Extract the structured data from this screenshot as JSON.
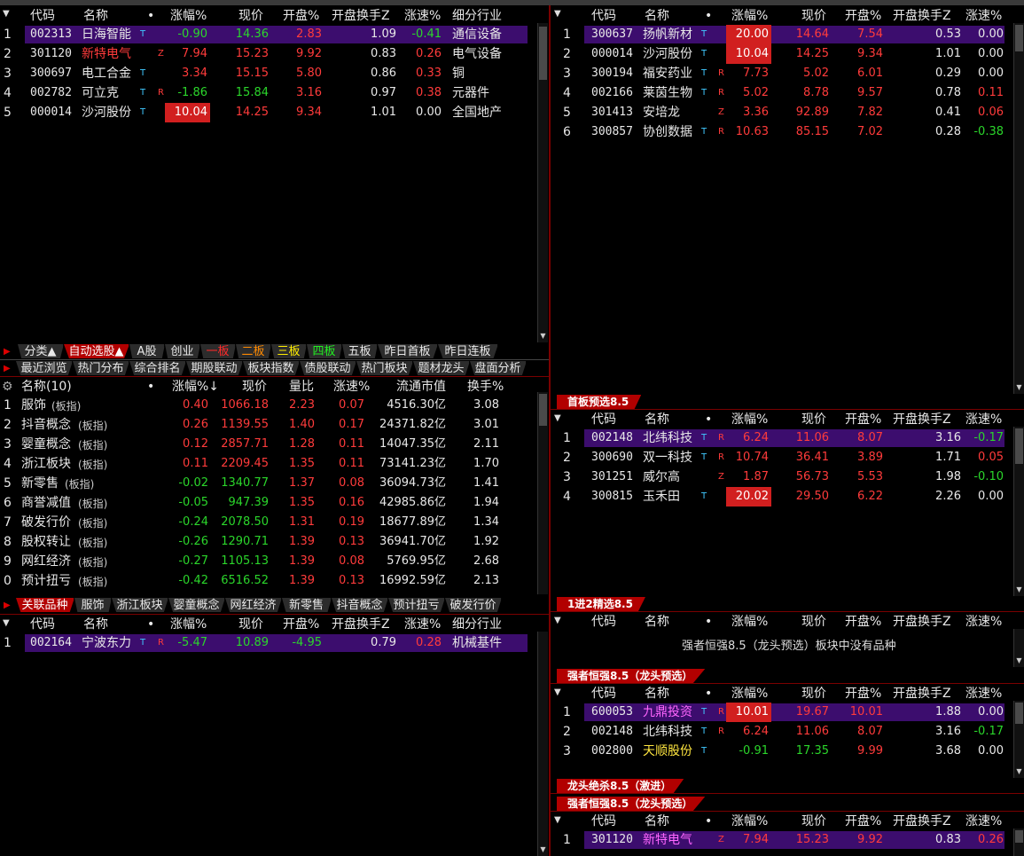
{
  "top_tabs": [
    "",
    "",
    "",
    "",
    "",
    "",
    "",
    "",
    "",
    "",
    "",
    "",
    "",
    "",
    "",
    "",
    "",
    ""
  ],
  "headers": {
    "code": "代码",
    "name": "名称",
    "dot": "•",
    "pct": "涨幅%",
    "price": "现价",
    "open_pct": "开盘%",
    "open_turnover": "开盘换手Z",
    "speed": "涨速%",
    "industry": "细分行业",
    "sector_name": "名称(10)",
    "sector_pct": "涨幅%↓",
    "volume_ratio": "量比",
    "sector_speed": "涨速%",
    "float_cap": "流通市值",
    "turnover": "换手%"
  },
  "left_top": {
    "rows": [
      {
        "idx": "1",
        "code": "002313",
        "name": "日海智能",
        "sup": "T",
        "flag": "",
        "pct": "-0.90",
        "price": "14.36",
        "open": "2.83",
        "turn": "1.09",
        "speed": "-0.41",
        "ind": "通信设备",
        "selected": true
      },
      {
        "idx": "2",
        "code": "301120",
        "name": "新特电气",
        "sup": "",
        "flag": "Z",
        "pct": "7.94",
        "price": "15.23",
        "open": "9.92",
        "turn": "0.83",
        "speed": "0.26",
        "ind": "电气设备",
        "selected": false
      },
      {
        "idx": "3",
        "code": "300697",
        "name": "电工合金",
        "sup": "T",
        "flag": "",
        "pct": "3.34",
        "price": "15.15",
        "open": "5.80",
        "turn": "0.86",
        "speed": "0.33",
        "ind": "铜",
        "selected": false
      },
      {
        "idx": "4",
        "code": "002782",
        "name": "可立克",
        "sup": "T",
        "flag": "R",
        "pct": "-1.86",
        "price": "15.84",
        "open": "3.16",
        "turn": "0.97",
        "speed": "0.38",
        "ind": "元器件",
        "selected": false
      },
      {
        "idx": "5",
        "code": "000014",
        "name": "沙河股份",
        "sup": "T",
        "flag": "",
        "pct": "10.04",
        "price": "14.25",
        "open": "9.34",
        "turn": "1.01",
        "speed": "0.00",
        "ind": "全国地产",
        "selected": false
      }
    ]
  },
  "tabbar1": [
    "分类▲",
    "自动选股▲",
    "A股",
    "创业",
    "一板",
    "二板",
    "三板",
    "四板",
    "五板",
    "昨日首板",
    "昨日连板"
  ],
  "tabbar2": [
    "最近浏览",
    "热门分布",
    "综合排名",
    "期股联动",
    "板块指数",
    "债股联动",
    "热门板块",
    "题材龙头",
    "盘面分析"
  ],
  "sectors": {
    "rows": [
      {
        "idx": "1",
        "name": "服饰",
        "tag": "(板指)",
        "pct": "0.40",
        "price": "1066.18",
        "vr": "2.23",
        "speed": "0.07",
        "cap": "4516.30亿",
        "turn": "3.08"
      },
      {
        "idx": "2",
        "name": "抖音概念",
        "tag": "(板指)",
        "pct": "0.26",
        "price": "1139.55",
        "vr": "1.40",
        "speed": "0.17",
        "cap": "24371.82亿",
        "turn": "3.01"
      },
      {
        "idx": "3",
        "name": "婴童概念",
        "tag": "(板指)",
        "pct": "0.12",
        "price": "2857.71",
        "vr": "1.28",
        "speed": "0.11",
        "cap": "14047.35亿",
        "turn": "2.11"
      },
      {
        "idx": "4",
        "name": "浙江板块",
        "tag": "(板指)",
        "pct": "0.11",
        "price": "2209.45",
        "vr": "1.35",
        "speed": "0.11",
        "cap": "73141.23亿",
        "turn": "1.70"
      },
      {
        "idx": "5",
        "name": "新零售",
        "tag": "(板指)",
        "pct": "-0.02",
        "price": "1340.77",
        "vr": "1.37",
        "speed": "0.08",
        "cap": "36094.73亿",
        "turn": "1.41"
      },
      {
        "idx": "6",
        "name": "商誉减值",
        "tag": "(板指)",
        "pct": "-0.05",
        "price": "947.39",
        "vr": "1.35",
        "speed": "0.16",
        "cap": "42985.86亿",
        "turn": "1.94"
      },
      {
        "idx": "7",
        "name": "破发行价",
        "tag": "(板指)",
        "pct": "-0.24",
        "price": "2078.50",
        "vr": "1.31",
        "speed": "0.19",
        "cap": "18677.89亿",
        "turn": "1.34"
      },
      {
        "idx": "8",
        "name": "股权转让",
        "tag": "(板指)",
        "pct": "-0.26",
        "price": "1290.71",
        "vr": "1.39",
        "speed": "0.13",
        "cap": "36941.70亿",
        "turn": "1.92"
      },
      {
        "idx": "9",
        "name": "网红经济",
        "tag": "(板指)",
        "pct": "-0.27",
        "price": "1105.13",
        "vr": "1.39",
        "speed": "0.08",
        "cap": "5769.95亿",
        "turn": "2.68"
      },
      {
        "idx": "0",
        "name": "预计扭亏",
        "tag": "(板指)",
        "pct": "-0.42",
        "price": "6516.52",
        "vr": "1.39",
        "speed": "0.13",
        "cap": "16992.59亿",
        "turn": "2.13"
      }
    ]
  },
  "tabbar3": [
    "关联品种",
    "服饰",
    "浙江板块",
    "婴童概念",
    "网红经济",
    "新零售",
    "抖音概念",
    "预计扭亏",
    "破发行价"
  ],
  "left_bottom": {
    "rows": [
      {
        "idx": "1",
        "code": "002164",
        "name": "宁波东力",
        "sup": "T",
        "flag": "R",
        "pct": "-5.47",
        "price": "10.89",
        "open": "-4.95",
        "turn": "0.79",
        "speed": "0.28",
        "ind": "机械基件",
        "selected": true
      }
    ]
  },
  "right_top": {
    "rows": [
      {
        "idx": "1",
        "code": "300637",
        "name": "扬帆新材",
        "sup": "T",
        "flag": "",
        "pct": "20.00",
        "price": "14.64",
        "open": "7.54",
        "turn": "0.53",
        "speed": "0.00",
        "selected": true,
        "boxed": true
      },
      {
        "idx": "2",
        "code": "000014",
        "name": "沙河股份",
        "sup": "T",
        "flag": "",
        "pct": "10.04",
        "price": "14.25",
        "open": "9.34",
        "turn": "1.01",
        "speed": "0.00",
        "selected": false,
        "boxed": true
      },
      {
        "idx": "3",
        "code": "300194",
        "name": "福安药业",
        "sup": "T",
        "flag": "R",
        "pct": "7.73",
        "price": "5.02",
        "open": "6.01",
        "turn": "0.29",
        "speed": "0.00",
        "selected": false,
        "boxed": false
      },
      {
        "idx": "4",
        "code": "002166",
        "name": "莱茵生物",
        "sup": "T",
        "flag": "R",
        "pct": "5.02",
        "price": "8.78",
        "open": "9.57",
        "turn": "0.78",
        "speed": "0.11",
        "selected": false,
        "boxed": false
      },
      {
        "idx": "5",
        "code": "301413",
        "name": "安培龙",
        "sup": "",
        "flag": "Z",
        "pct": "3.36",
        "price": "92.89",
        "open": "7.82",
        "turn": "0.41",
        "speed": "0.06",
        "selected": false,
        "boxed": false
      },
      {
        "idx": "6",
        "code": "300857",
        "name": "协创数据",
        "sup": "T",
        "flag": "R",
        "pct": "10.63",
        "price": "85.15",
        "open": "7.02",
        "turn": "0.28",
        "speed": "-0.38",
        "selected": false,
        "boxed": false
      }
    ]
  },
  "sec_first_board": {
    "title": "首板预选8.5",
    "rows": [
      {
        "idx": "1",
        "code": "002148",
        "name": "北纬科技",
        "sup": "T",
        "flag": "R",
        "pct": "6.24",
        "price": "11.06",
        "open": "8.07",
        "turn": "3.16",
        "speed": "-0.17",
        "selected": true,
        "boxed": false
      },
      {
        "idx": "2",
        "code": "300690",
        "name": "双一科技",
        "sup": "T",
        "flag": "R",
        "pct": "10.74",
        "price": "36.41",
        "open": "3.89",
        "turn": "1.71",
        "speed": "0.05",
        "selected": false,
        "boxed": false
      },
      {
        "idx": "3",
        "code": "301251",
        "name": "威尔高",
        "sup": "",
        "flag": "Z",
        "pct": "1.87",
        "price": "56.73",
        "open": "5.53",
        "turn": "1.98",
        "speed": "-0.10",
        "selected": false,
        "boxed": false
      },
      {
        "idx": "4",
        "code": "300815",
        "name": "玉禾田",
        "sup": "T",
        "flag": "",
        "pct": "20.02",
        "price": "29.50",
        "open": "6.22",
        "turn": "2.26",
        "speed": "0.00",
        "selected": false,
        "boxed": true
      }
    ]
  },
  "sec_1to2": {
    "title": "1进2精选8.5",
    "empty_msg": "强者恒强8.5（龙头预选）板块中没有品种"
  },
  "sec_strong": {
    "title": "强者恒强8.5（龙头预选）",
    "rows": [
      {
        "idx": "1",
        "code": "600053",
        "name": "九鼎投资",
        "sup": "T",
        "flag": "R",
        "pct": "10.01",
        "price": "19.67",
        "open": "10.01",
        "turn": "1.88",
        "speed": "0.00",
        "selected": true,
        "boxed": true,
        "namecolor": "pink"
      },
      {
        "idx": "2",
        "code": "002148",
        "name": "北纬科技",
        "sup": "T",
        "flag": "R",
        "pct": "6.24",
        "price": "11.06",
        "open": "8.07",
        "turn": "3.16",
        "speed": "-0.17",
        "selected": false,
        "boxed": false,
        "namecolor": "white"
      },
      {
        "idx": "3",
        "code": "002800",
        "name": "天顺股份",
        "sup": "T",
        "flag": "",
        "pct": "-0.91",
        "price": "17.35",
        "open": "9.99",
        "turn": "3.68",
        "speed": "0.00",
        "selected": false,
        "boxed": false,
        "namecolor": "yellow"
      }
    ]
  },
  "sec_dragon": {
    "title": "龙头绝杀8.5（激进）"
  },
  "sec_strong2": {
    "title": "强者恒强8.5（龙头预选）",
    "rows": [
      {
        "idx": "1",
        "code": "301120",
        "name": "新特电气",
        "sup": "",
        "flag": "Z",
        "pct": "7.94",
        "price": "15.23",
        "open": "9.92",
        "turn": "0.83",
        "speed": "0.26",
        "selected": true,
        "boxed": false,
        "namecolor": "pink"
      }
    ]
  },
  "colors": {
    "up": "#ff3b3b",
    "down": "#2bd62b",
    "select": "#3c0d6e",
    "accent": "#b20000",
    "info": "#40c8ff"
  }
}
